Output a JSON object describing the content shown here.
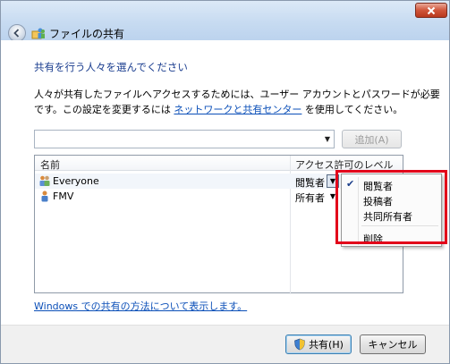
{
  "window": {
    "title": "ファイルの共有"
  },
  "main": {
    "heading": "共有を行う人々を選んでください",
    "description_before_link": "人々が共有したファイルへアクセスするためには、ユーザー アカウントとパスワードが必要です。この設定を変更するには ",
    "description_link": "ネットワークと共有センター",
    "description_after_link": " を使用してください。",
    "combo": {
      "value": ""
    },
    "add_button": "追加(A)",
    "list": {
      "columns": {
        "name": "名前",
        "level": "アクセス許可のレベル"
      },
      "rows": [
        {
          "name": "Everyone",
          "level": "閲覧者",
          "icon": "group-icon"
        },
        {
          "name": "FMV",
          "level": "所有者",
          "icon": "user-icon"
        }
      ]
    },
    "help_link": "Windows での共有の方法について表示します。"
  },
  "context_menu": {
    "items": [
      "閲覧者",
      "投稿者",
      "共同所有者",
      "削除"
    ],
    "checked_index": 0,
    "check_icon": "checkmark-icon"
  },
  "footer": {
    "share_button": "共有(H)",
    "cancel_button": "キャンセル"
  },
  "colors": {
    "highlight": "#e2001a",
    "link": "#0b4fb8",
    "heading": "#1a3d8f"
  }
}
